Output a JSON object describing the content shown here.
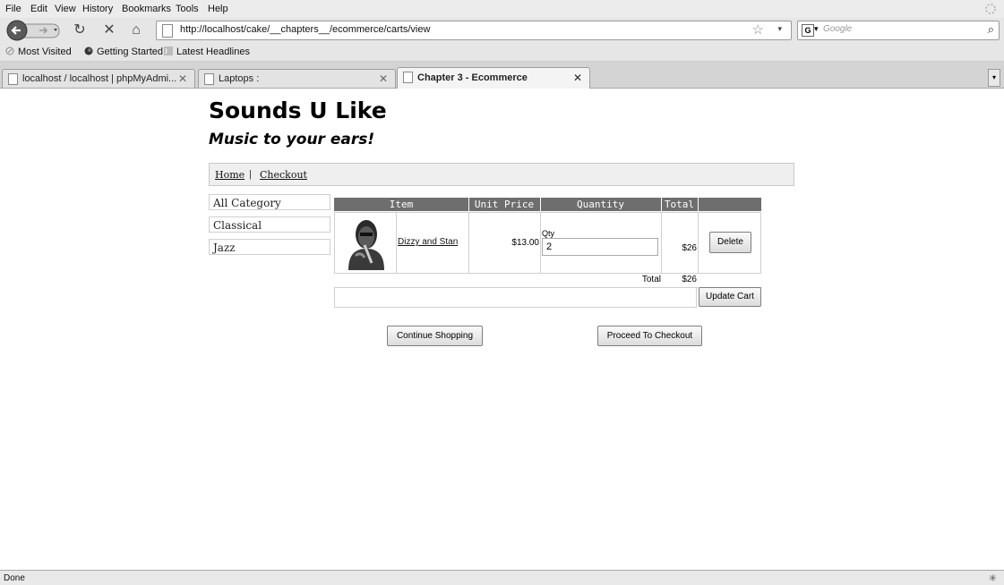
{
  "browser": {
    "menu": [
      "File",
      "Edit",
      "View",
      "History",
      "Bookmarks",
      "Tools",
      "Help"
    ],
    "url": "http://localhost/cake/__chapters__/ecommerce/carts/view",
    "search_placeholder": "Google",
    "bookmarks": [
      "Most Visited",
      "Getting Started",
      "Latest Headlines"
    ],
    "tabs": [
      {
        "label": "localhost / localhost | phpMyAdmi..."
      },
      {
        "label": "Laptops :"
      },
      {
        "label": "Chapter 3 - Ecommerce"
      }
    ],
    "status": "Done"
  },
  "site": {
    "title": "Sounds U Like",
    "tagline": "Music to your ears!",
    "nav": [
      "Home",
      "|",
      "Checkout"
    ]
  },
  "sidebar": {
    "categories": [
      "All Category",
      "Classical",
      "Jazz"
    ]
  },
  "cart": {
    "headers": [
      "Item",
      "Unit Price",
      "Quantity",
      "Total"
    ],
    "row": {
      "item": "Dizzy and Stan",
      "unit_price": "$13.00",
      "qty_label": "Qty",
      "qty_value": "2",
      "total": "$26",
      "delete_label": "Delete"
    },
    "total_label": "Total",
    "total_value": "$26",
    "update_label": "Update Cart"
  },
  "actions": {
    "continue_label": "Continue Shopping",
    "checkout_label": "Proceed To Checkout"
  }
}
